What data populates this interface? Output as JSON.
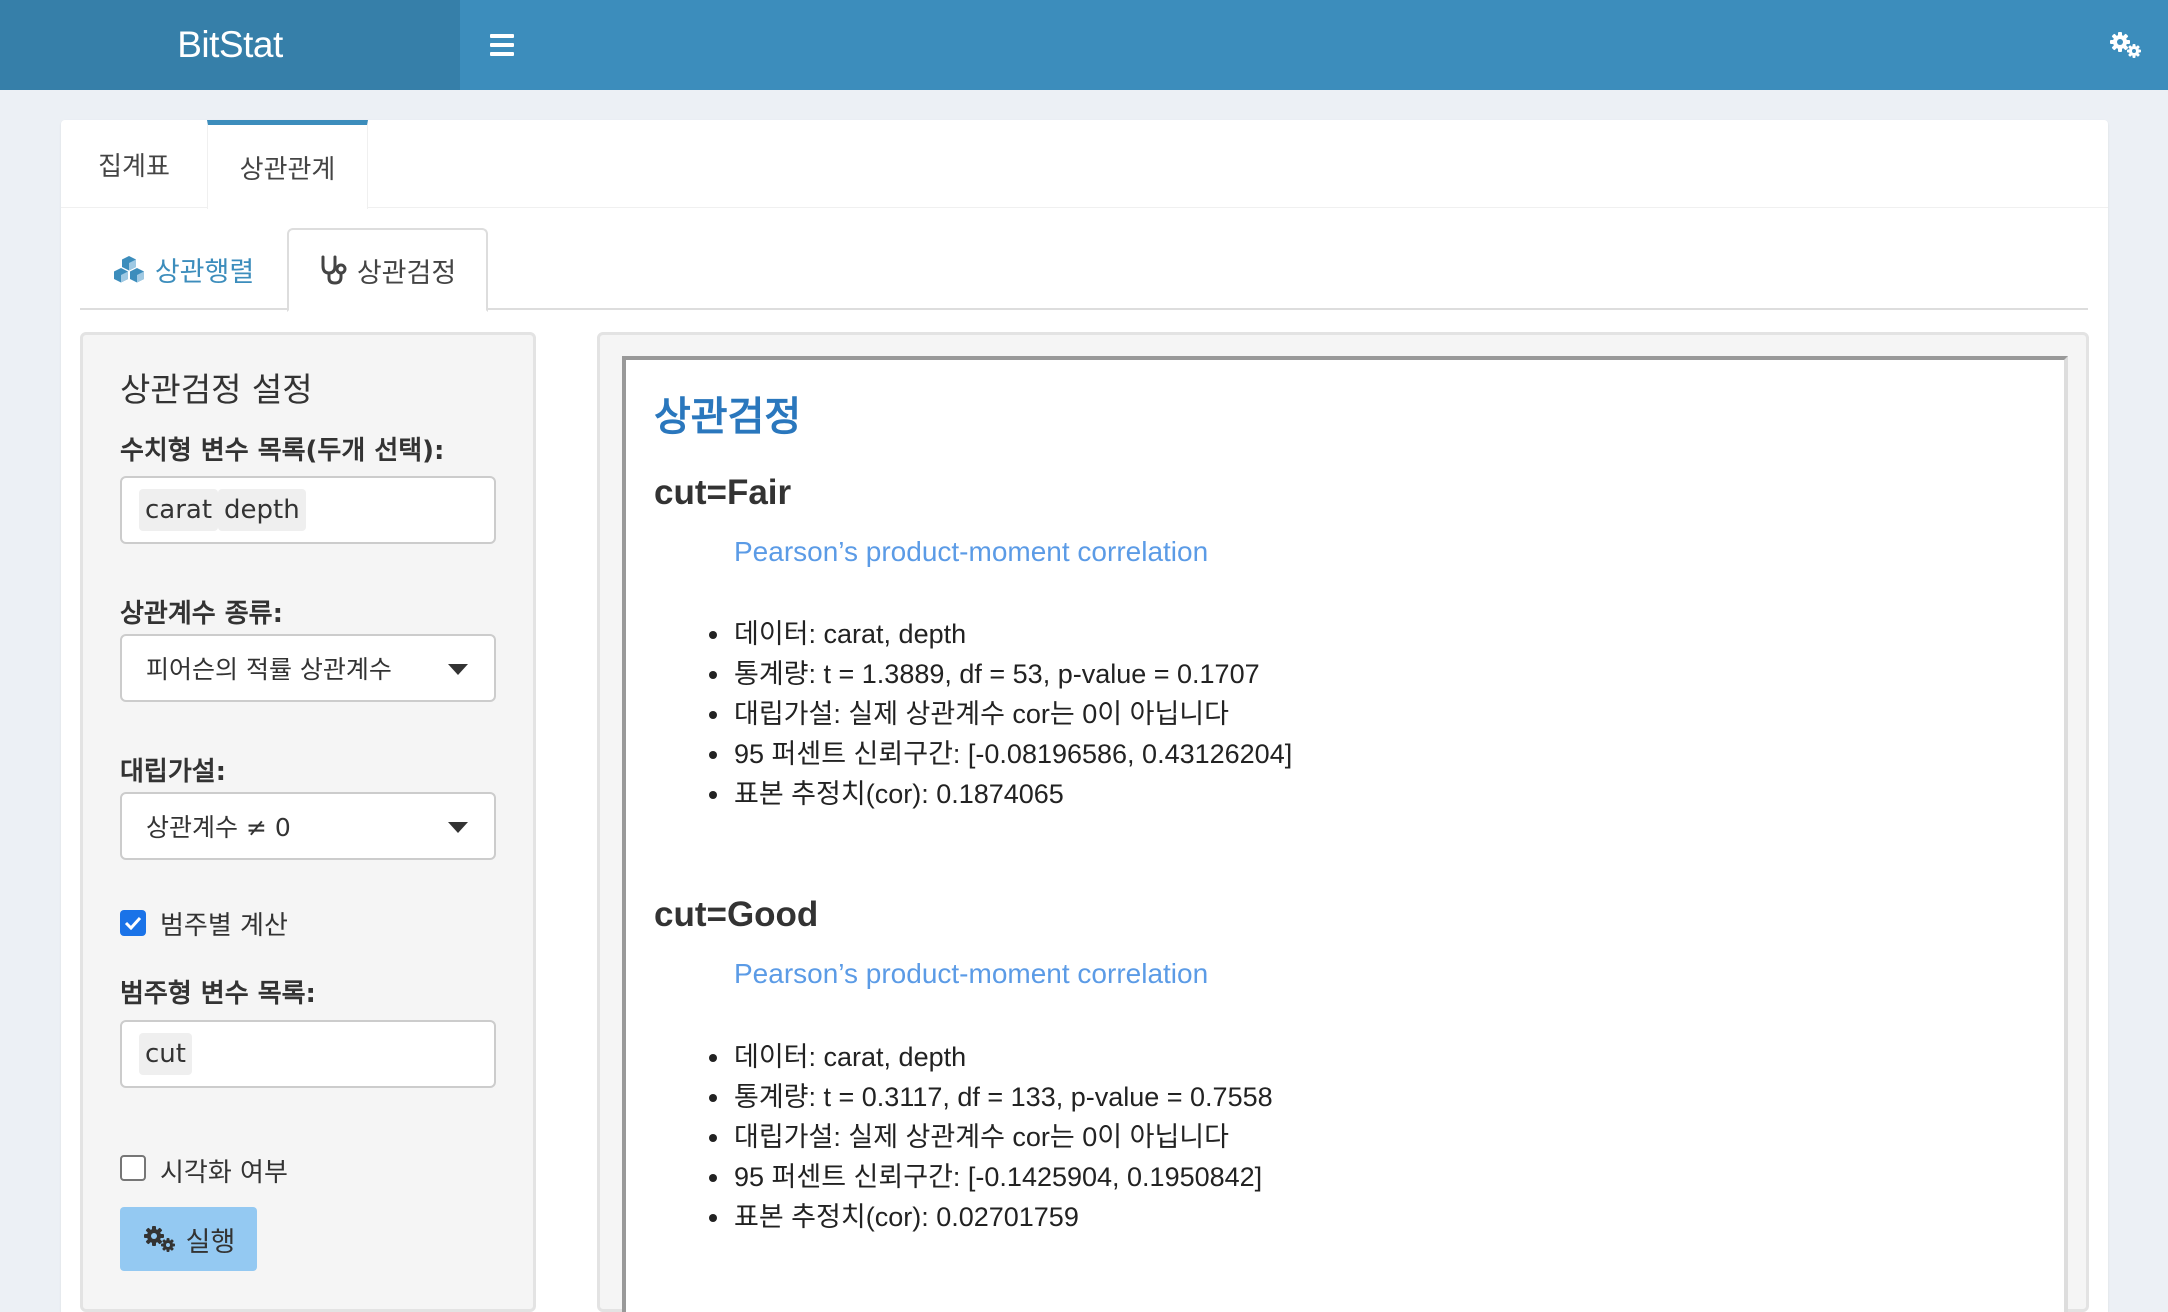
{
  "app": {
    "logo": "BitStat"
  },
  "header": {
    "menu_icon": "hamburger-icon",
    "settings_icon": "gears-icon"
  },
  "outer_tabs": [
    {
      "label": "집계표",
      "active": false
    },
    {
      "label": "상관관계",
      "active": true
    }
  ],
  "inner_tabs": [
    {
      "label": "상관행렬",
      "icon": "cubes-icon",
      "active": false
    },
    {
      "label": "상관검정",
      "icon": "stethoscope-icon",
      "active": true
    }
  ],
  "sidebar": {
    "title": "상관검정 설정",
    "numeric_label": "수치형 변수 목록(두개 선택):",
    "numeric_selected": [
      "carat",
      "depth"
    ],
    "cor_type_label": "상관계수 종류:",
    "cor_type_value": "피어슨의 적률 상관계수",
    "alt_label": "대립가설:",
    "alt_value": "상관계수 ≠ 0",
    "by_category_label": "범주별 계산",
    "by_category_checked": true,
    "cat_label": "범주형 변수 목록:",
    "cat_selected": [
      "cut"
    ],
    "visualize_label": "시각화 여부",
    "visualize_checked": false,
    "run_label": "실행"
  },
  "result": {
    "title": "상관검정",
    "groups": [
      {
        "heading": "cut=Fair",
        "method": "Pearson’s product-moment correlation",
        "lines": [
          "데이터: carat, depth",
          "통계량: t = 1.3889, df = 53, p-value = 0.1707",
          "대립가설: 실제 상관계수 cor는 0이 아닙니다",
          "95 퍼센트 신뢰구간: [-0.08196586, 0.43126204]",
          "표본 추정치(cor): 0.1874065"
        ]
      },
      {
        "heading": "cut=Good",
        "method": "Pearson’s product-moment correlation",
        "lines": [
          "데이터: carat, depth",
          "통계량: t = 0.3117, df = 133, p-value = 0.7558",
          "대립가설: 실제 상관계수 cor는 0이 아닙니다",
          "95 퍼센트 신뢰구간: [-0.1425904, 0.1950842]",
          "표본 추정치(cor): 0.02701759"
        ]
      }
    ]
  },
  "colors": {
    "header": "#3c8dbc",
    "logo_bg": "#367fa9",
    "accent": "#2a77bd",
    "method_text": "#5b9be6",
    "run_button": "#94c9f2"
  }
}
